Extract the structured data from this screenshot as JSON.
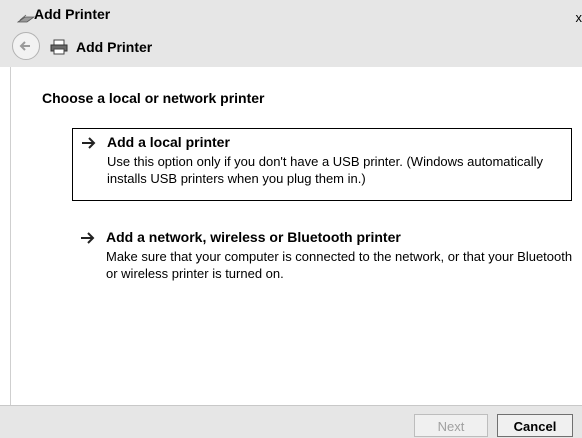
{
  "window": {
    "title": "Add Printer",
    "close_glyph": "x"
  },
  "nav": {
    "title": "Add Printer",
    "back_icon": "back-arrow-icon",
    "printer_icon": "printer-icon"
  },
  "main": {
    "heading": "Choose a local or network printer",
    "options": [
      {
        "title": "Add a local printer",
        "description": "Use this option only if you don't have a USB printer. (Windows automatically installs USB printers when you plug them in.)",
        "selected": true,
        "icon": "arrow-right-icon"
      },
      {
        "title": "Add a network, wireless or Bluetooth printer",
        "description": "Make sure that your computer is connected to the network, or that your Bluetooth or wireless printer is turned on.",
        "selected": false,
        "icon": "arrow-right-icon"
      }
    ]
  },
  "footer": {
    "next_label": "Next",
    "next_enabled": false,
    "cancel_label": "Cancel"
  },
  "colors": {
    "chrome_bg": "#e6e6e6",
    "content_bg": "#ffffff",
    "disabled_text": "#a0a0a0",
    "border": "#000000"
  }
}
